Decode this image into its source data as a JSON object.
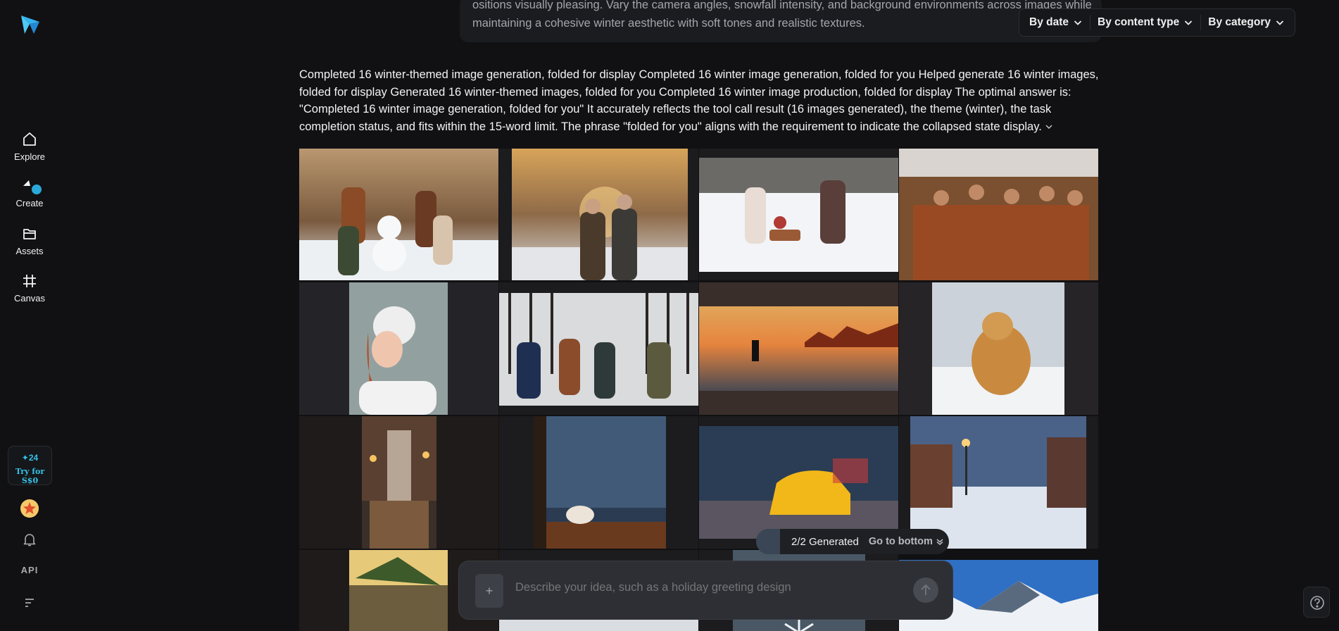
{
  "sidebar": {
    "items": [
      {
        "label": "Explore",
        "icon": "home-icon"
      },
      {
        "label": "Create",
        "icon": "create-icon"
      },
      {
        "label": "Assets",
        "icon": "folder-icon"
      },
      {
        "label": "Canvas",
        "icon": "canvas-icon"
      }
    ],
    "credits": {
      "amount": "✦24",
      "offer": "Try for S$0"
    },
    "api_label": "API"
  },
  "prompt_text": "ositions visually pleasing. Vary the camera angles, snowfall intensity, and background environments across images while maintaining a cohesive winter aesthetic with soft tones and realistic textures.",
  "filters": [
    "By date",
    "By content type",
    "By category"
  ],
  "answer_text": "Completed 16 winter-themed image generation, folded for display Completed 16 winter image generation, folded for you Helped generate 16 winter images, folded for display Generated 16 winter-themed images, folded for you Completed 16 winter image production, folded for display The optimal answer is: \"Completed 16 winter image generation, folded for you\" It accurately reflects the tool call result (16 images generated), the theme (winter), the task completion status, and fits within the 15-word limit. The phrase \"folded for you\" aligns with the requirement to indicate the collapsed state display.",
  "gallery": [
    {
      "desc": "family-snowman"
    },
    {
      "desc": "elderly-couple-walk"
    },
    {
      "desc": "sled-family"
    },
    {
      "desc": "family-cocoa-cabin"
    },
    {
      "desc": "girl-catching-snow"
    },
    {
      "desc": "snowball-fight"
    },
    {
      "desc": "frozen-lake-skater"
    },
    {
      "desc": "golden-retriever-snow"
    },
    {
      "desc": "city-street-night"
    },
    {
      "desc": "coffee-window"
    },
    {
      "desc": "yellow-taxi"
    },
    {
      "desc": "snowy-street-lamp"
    },
    {
      "desc": "snowy-pine"
    },
    {
      "desc": "snowy-path"
    },
    {
      "desc": "snowflake"
    },
    {
      "desc": "mountains"
    }
  ],
  "generated": {
    "count": "2/2 Generated",
    "goto": "Go to bottom"
  },
  "composer": {
    "placeholder": "Describe your idea, such as a holiday greeting design",
    "plus": "+"
  },
  "colors": {
    "accent": "#34c3e8",
    "background": "#111113",
    "badge": "#2ba8d9"
  }
}
